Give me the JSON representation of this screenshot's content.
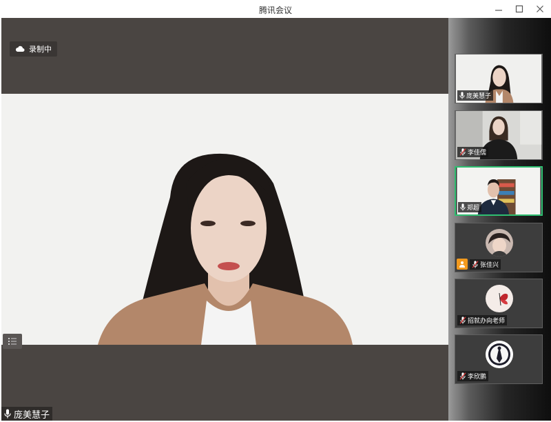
{
  "window": {
    "title": "腾讯会议"
  },
  "recording": {
    "label": "录制中"
  },
  "main_speaker": {
    "name": "庞美慧子"
  },
  "participants": [
    {
      "name": "庞美慧子",
      "mic": "on",
      "type": "camera"
    },
    {
      "name": "李佳儒",
      "mic": "muted",
      "type": "camera"
    },
    {
      "name": "郑超",
      "mic": "on",
      "type": "camera",
      "active": true
    },
    {
      "name": "张佳兴",
      "mic": "muted",
      "type": "avatar",
      "host_badge": true
    },
    {
      "name": "招就办向老师",
      "mic": "muted",
      "type": "avatar"
    },
    {
      "name": "李欣鹏",
      "mic": "muted",
      "type": "avatar"
    }
  ],
  "colors": {
    "active_border": "#2fbf71",
    "muted_slash": "#e03a3a",
    "host_badge": "#f39a1e"
  }
}
